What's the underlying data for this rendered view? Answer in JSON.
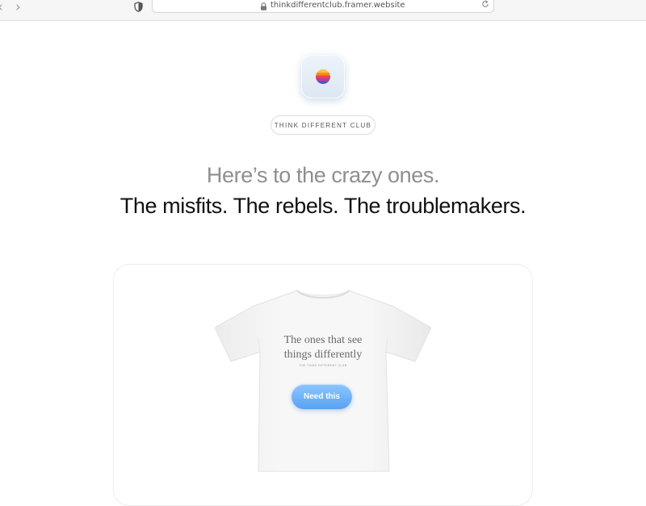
{
  "browser": {
    "back_glyph": "‹",
    "forward_glyph": "›",
    "url": "thinkdifferentclub.framer.website",
    "icons": [
      "back-icon",
      "forward-icon",
      "shield-icon",
      "lock-icon",
      "reload-icon"
    ]
  },
  "hero": {
    "badge": "THINK DIFFERENT CLUB",
    "headline_muted": "Here’s to the crazy ones.",
    "headline_strong": "The misfits. The rebels. The troublemakers.",
    "logo_icon": "rainbow-circle-icon"
  },
  "product": {
    "shirt_text_line1": "The ones that see",
    "shirt_text_line2": "things differently",
    "shirt_small_text": "THE THINK DIFFERENT CLUB",
    "cta_label": "Need this"
  },
  "colors": {
    "accent": "#5aa2f2",
    "muted_text": "#8e8e93",
    "strong_text": "#111111"
  }
}
